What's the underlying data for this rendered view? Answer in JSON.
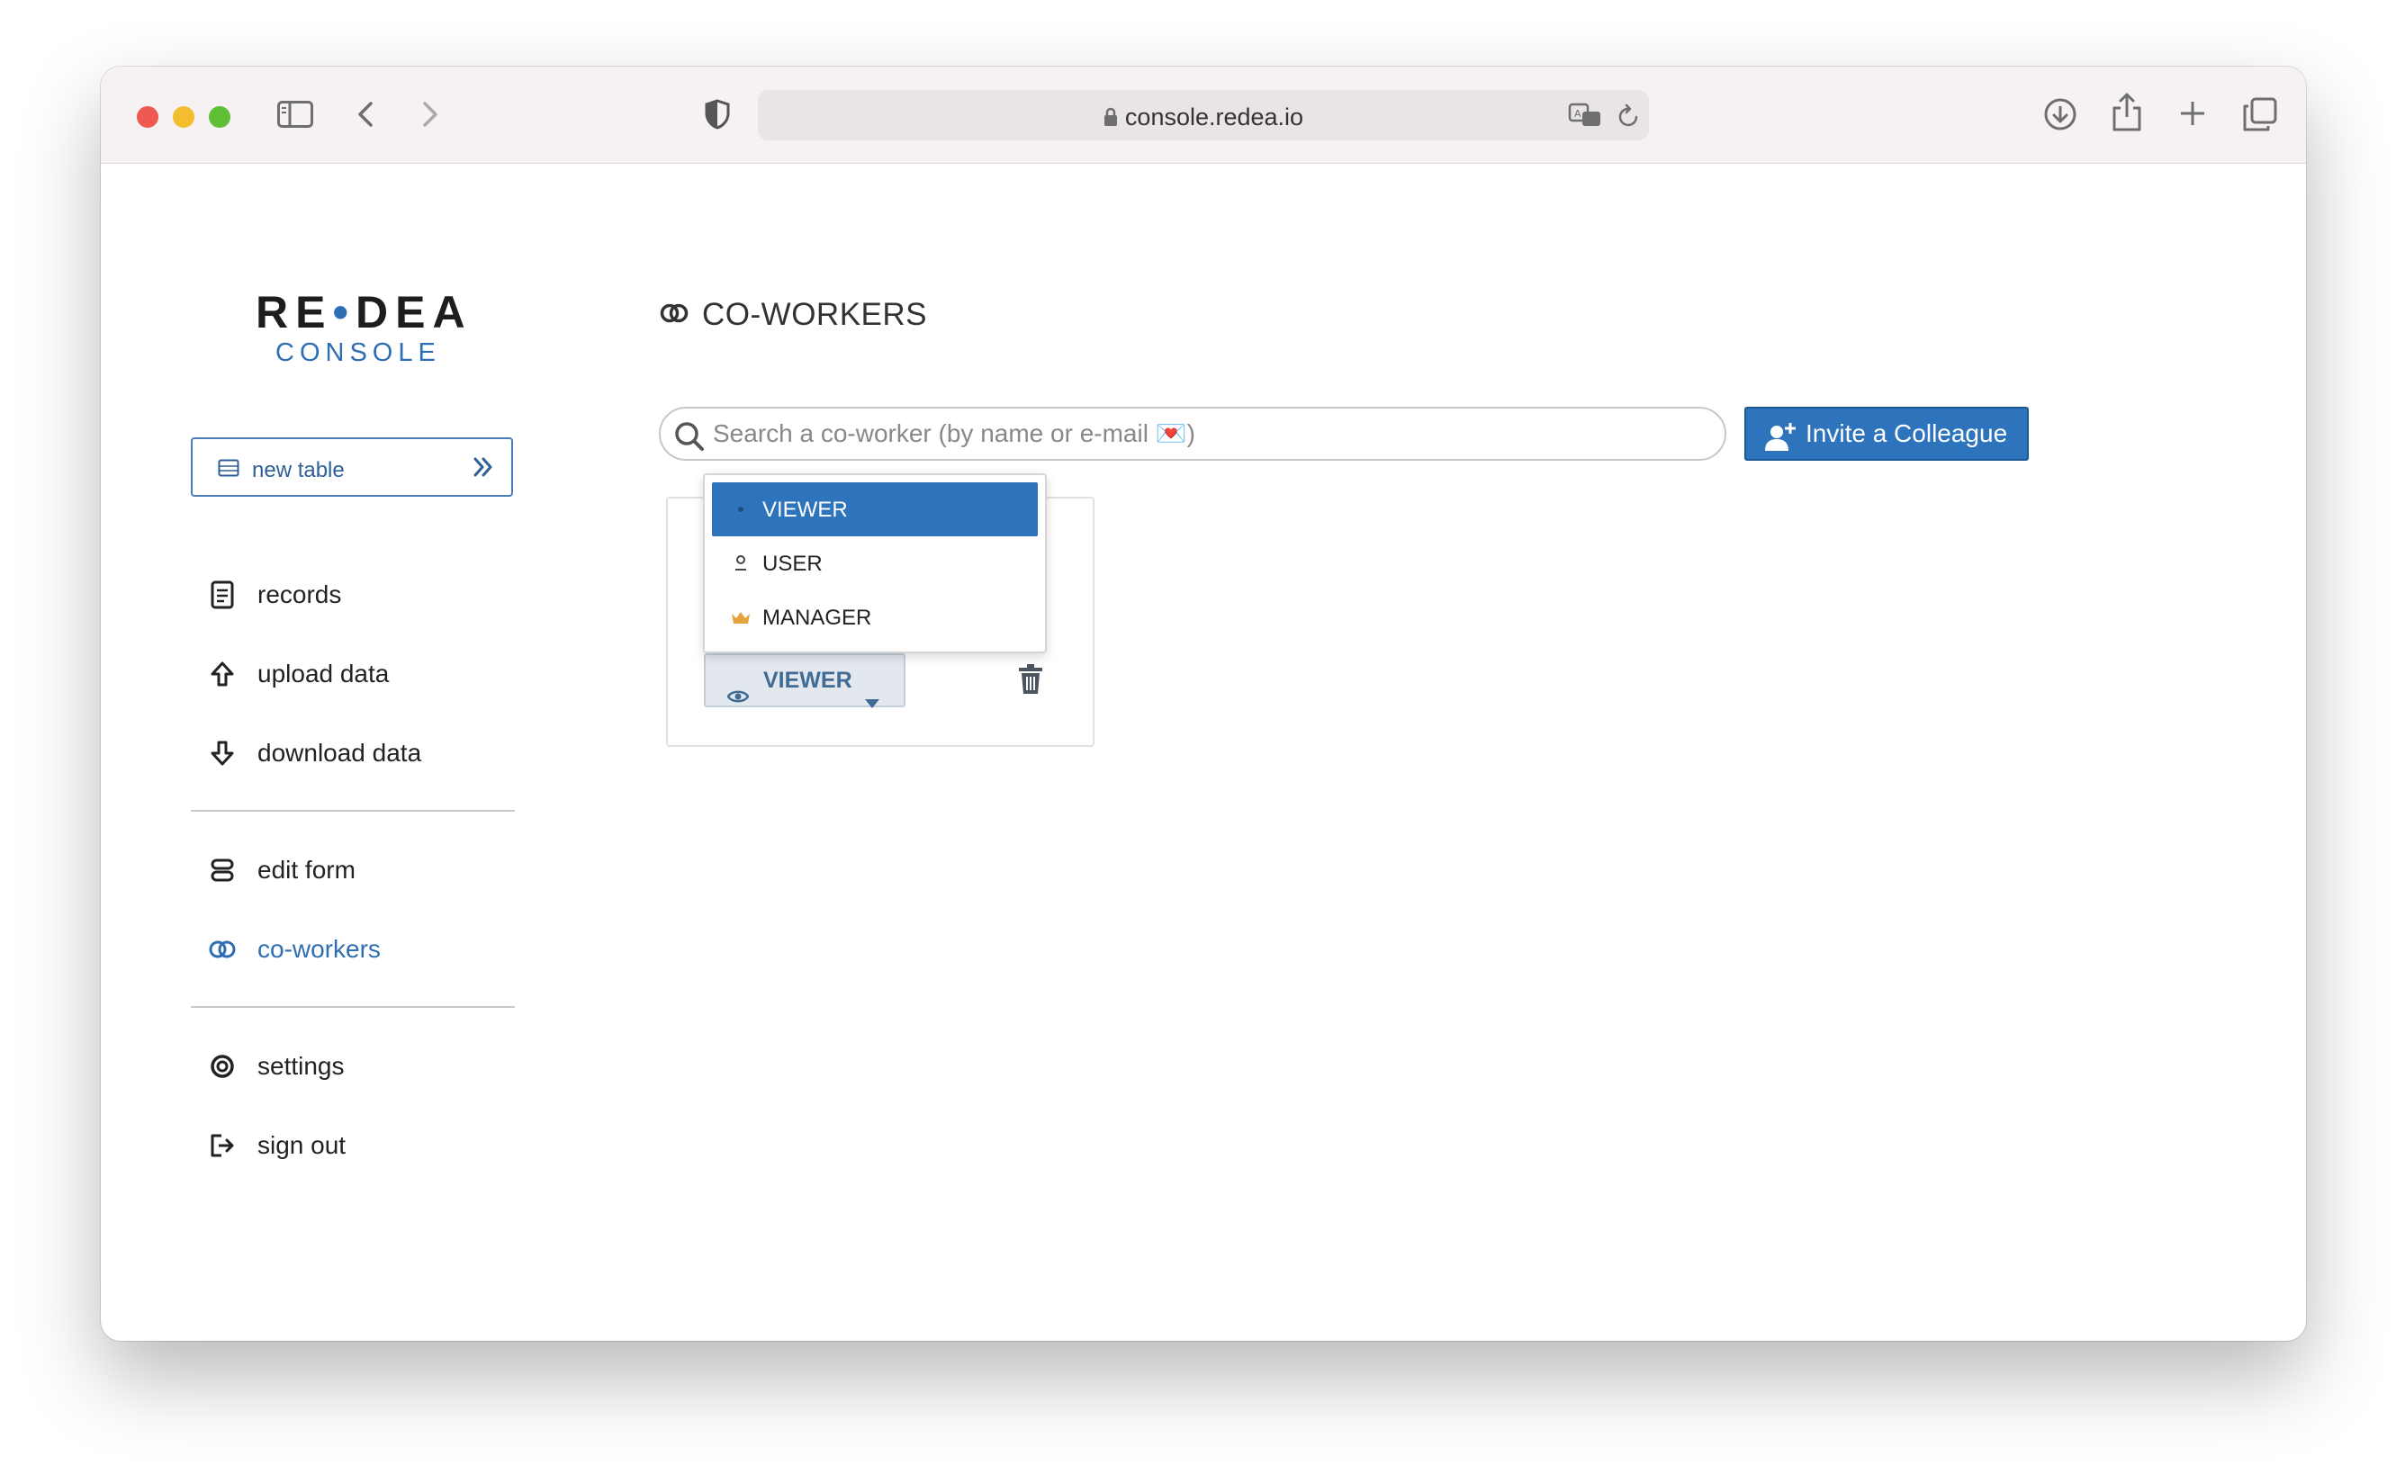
{
  "browser": {
    "url": "console.redea.io"
  },
  "brand": {
    "name_left": "RE",
    "name_dot": "•",
    "name_right": "DEA",
    "subtitle": "CONSOLE"
  },
  "sidebar": {
    "new_table_label": "new table",
    "items": [
      {
        "label": "records",
        "icon": "document-icon"
      },
      {
        "label": "upload data",
        "icon": "arrow-up-icon"
      },
      {
        "label": "download data",
        "icon": "arrow-down-icon"
      },
      {
        "label": "edit form",
        "icon": "form-icon"
      },
      {
        "label": "co-workers",
        "icon": "rings-icon",
        "active": true
      },
      {
        "label": "settings",
        "icon": "settings-icon"
      },
      {
        "label": "sign out",
        "icon": "sign-out-icon"
      }
    ]
  },
  "page": {
    "title": "CO-WORKERS"
  },
  "search": {
    "placeholder": "Search a co-worker (by name or e-mail 💌)"
  },
  "invite_button": {
    "label": "Invite a Colleague"
  },
  "role_dropdown": {
    "current": "VIEWER",
    "options": [
      {
        "label": "VIEWER",
        "icon": "dot-icon",
        "selected": true
      },
      {
        "label": "USER",
        "icon": "user-icon"
      },
      {
        "label": "MANAGER",
        "icon": "crown-icon"
      }
    ]
  },
  "colors": {
    "accent": "#2e74bd",
    "brand": "#2e6eb4",
    "crown": "#e6a23c"
  }
}
